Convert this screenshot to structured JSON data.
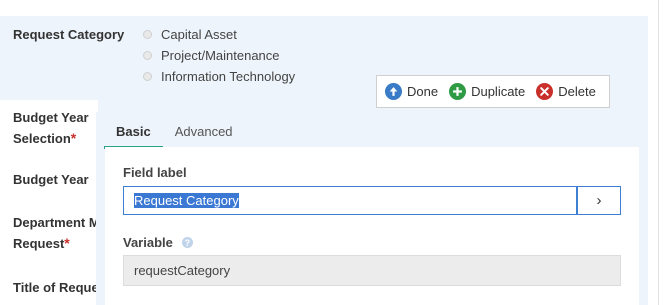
{
  "selected_row": {
    "label": "Request Category",
    "options": [
      "Capital Asset",
      "Project/Maintenance",
      "Information Technology"
    ]
  },
  "toolbar": {
    "done_label": "Done",
    "duplicate_label": "Duplicate",
    "delete_label": "Delete",
    "done_icon": "arrow-up-icon",
    "duplicate_icon": "plus-icon",
    "delete_icon": "x-icon"
  },
  "left_labels": {
    "budget_year_selection_line1": "Budget Year",
    "budget_year_selection_line2": "Selection",
    "budget_year": "Budget Year",
    "department_line1": "Department M",
    "department_line2": "Request",
    "title_of_request": "Title of Reque",
    "required_marker": "*"
  },
  "tabs": {
    "basic": "Basic",
    "advanced": "Advanced"
  },
  "field": {
    "label": "Field label",
    "value": "Request Category",
    "arrow": "›"
  },
  "variable": {
    "label": "Variable",
    "value": "requestCategory",
    "help_icon": "help-icon"
  },
  "colors": {
    "accent": "#2fa08a",
    "done": "#3a7bc8",
    "duplicate": "#2e9a44",
    "delete": "#c9302c",
    "selection": "#3a78d4",
    "panel": "#eef4fb"
  }
}
